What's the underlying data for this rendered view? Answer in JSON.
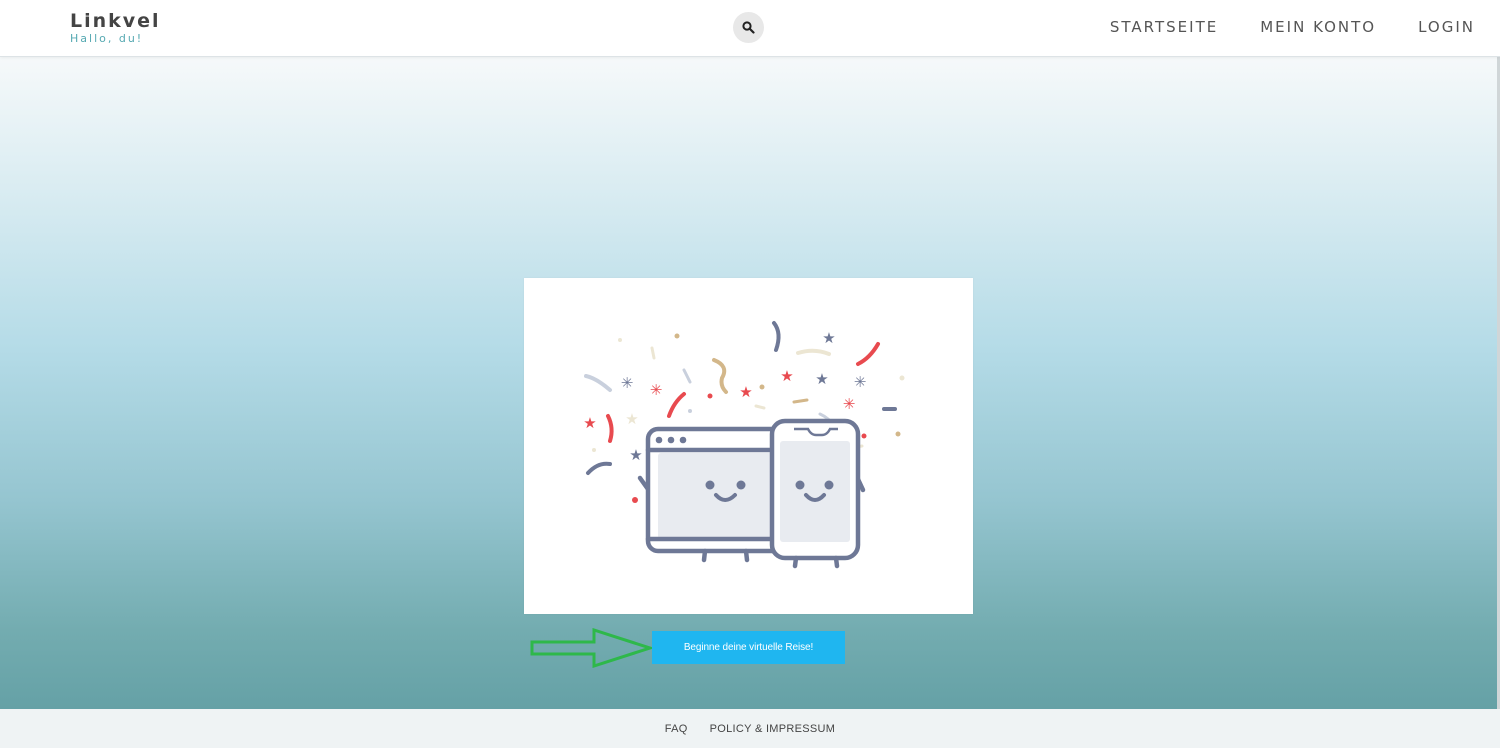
{
  "header": {
    "brand_name": "Linkvel",
    "brand_tagline": "Hallo, du!",
    "search_icon": "search-icon",
    "nav": [
      {
        "label": "STARTSEITE"
      },
      {
        "label": "MEIN KONTO"
      },
      {
        "label": "LOGIN"
      }
    ]
  },
  "main": {
    "illustration": "celebrating-browser-and-phone-with-confetti",
    "cta_label": "Beginne deine virtuelle Reise!",
    "annotation_icon": "green-arrow-right-icon"
  },
  "footer": {
    "links": [
      {
        "label": "FAQ"
      },
      {
        "label": "POLICY & IMPRESSUM"
      }
    ]
  },
  "colors": {
    "accent": "#1fb6f0",
    "brand_tagline": "#56a9b2",
    "illustration_stroke": "#6e7896",
    "confetti_red": "#e84a4f",
    "annotation_arrow": "#2eb84a"
  }
}
